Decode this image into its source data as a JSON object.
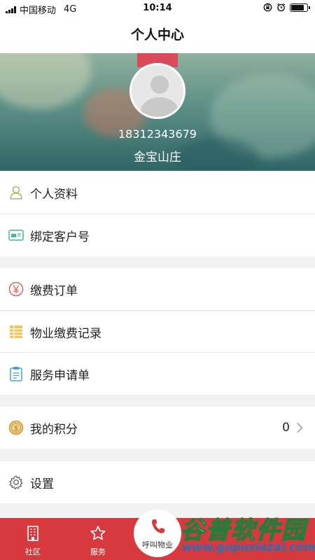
{
  "status_bar": {
    "carrier": "中国移动",
    "network": "4G",
    "time": "10:14",
    "battery_level": 0.85
  },
  "nav": {
    "title": "个人中心"
  },
  "profile": {
    "phone": "18312343679",
    "community": "金宝山庄"
  },
  "menu": {
    "personal_info": {
      "label": "个人资料",
      "icon": "person-icon"
    },
    "bind_account": {
      "label": "绑定客户号",
      "icon": "id-card-icon"
    },
    "payment_orders": {
      "label": "缴费订单",
      "icon": "yen-icon"
    },
    "property_payment_records": {
      "label": "物业缴费记录",
      "icon": "ledger-icon"
    },
    "service_requests": {
      "label": "服务申请单",
      "icon": "clipboard-icon"
    },
    "my_points": {
      "label": "我的积分",
      "value": "0",
      "icon": "coin-icon"
    },
    "settings": {
      "label": "设置",
      "icon": "gear-icon"
    }
  },
  "tabbar": {
    "community_label": "社区",
    "service_label": "服务",
    "call_label": "呼叫物业"
  },
  "watermark": {
    "title": "谷普软件园",
    "url": "www.gupuxiazai.com"
  },
  "colors": {
    "accent": "#d63a3e",
    "header_teal": "#2f6566",
    "background": "#f2f2f2"
  }
}
